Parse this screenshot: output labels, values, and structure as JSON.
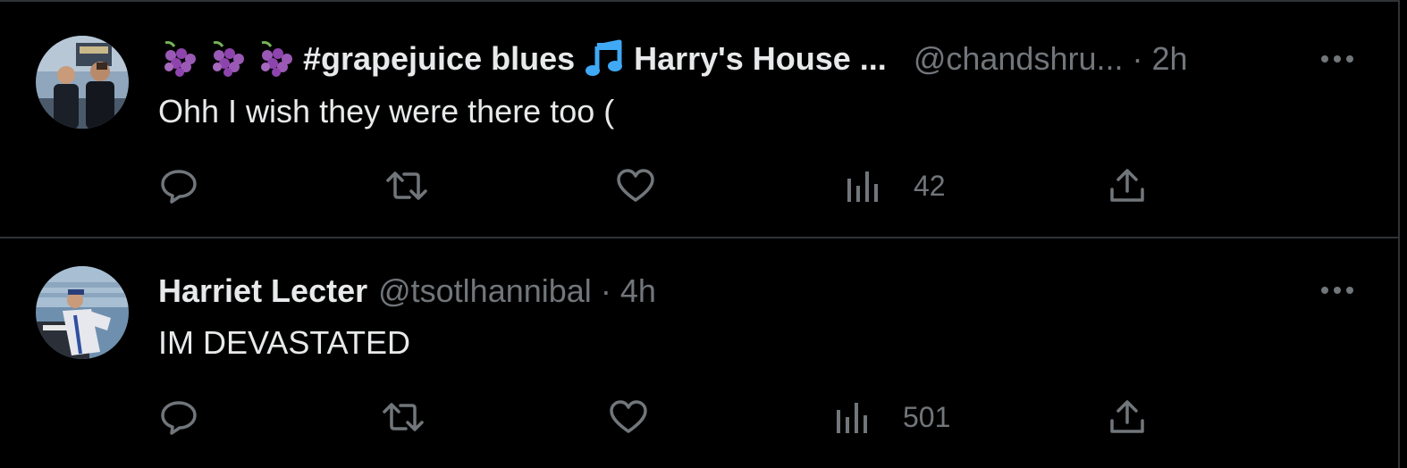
{
  "tweets": [
    {
      "display_name": "#grapejuice blues",
      "display_name_suffix": "Harry's House ...",
      "leading_emojis": [
        "grapes-emoji",
        "grapes-emoji",
        "grapes-emoji"
      ],
      "inline_emoji": "musical-note-emoji",
      "handle": "@chandshru...",
      "separator": "·",
      "time": "2h",
      "text": "Ohh I wish they were there too (",
      "views": "42"
    },
    {
      "display_name": "Harriet Lecter",
      "handle": "@tsotlhannibal",
      "separator": "·",
      "time": "4h",
      "text": "IM DEVASTATED",
      "views": "501"
    }
  ],
  "colors": {
    "background": "#000000",
    "primary_text": "#e7e9ea",
    "secondary_text": "#71767b",
    "divider": "#2f3336",
    "note_blue": "#3fa9f5",
    "grape_purple": "#8e44ad"
  }
}
